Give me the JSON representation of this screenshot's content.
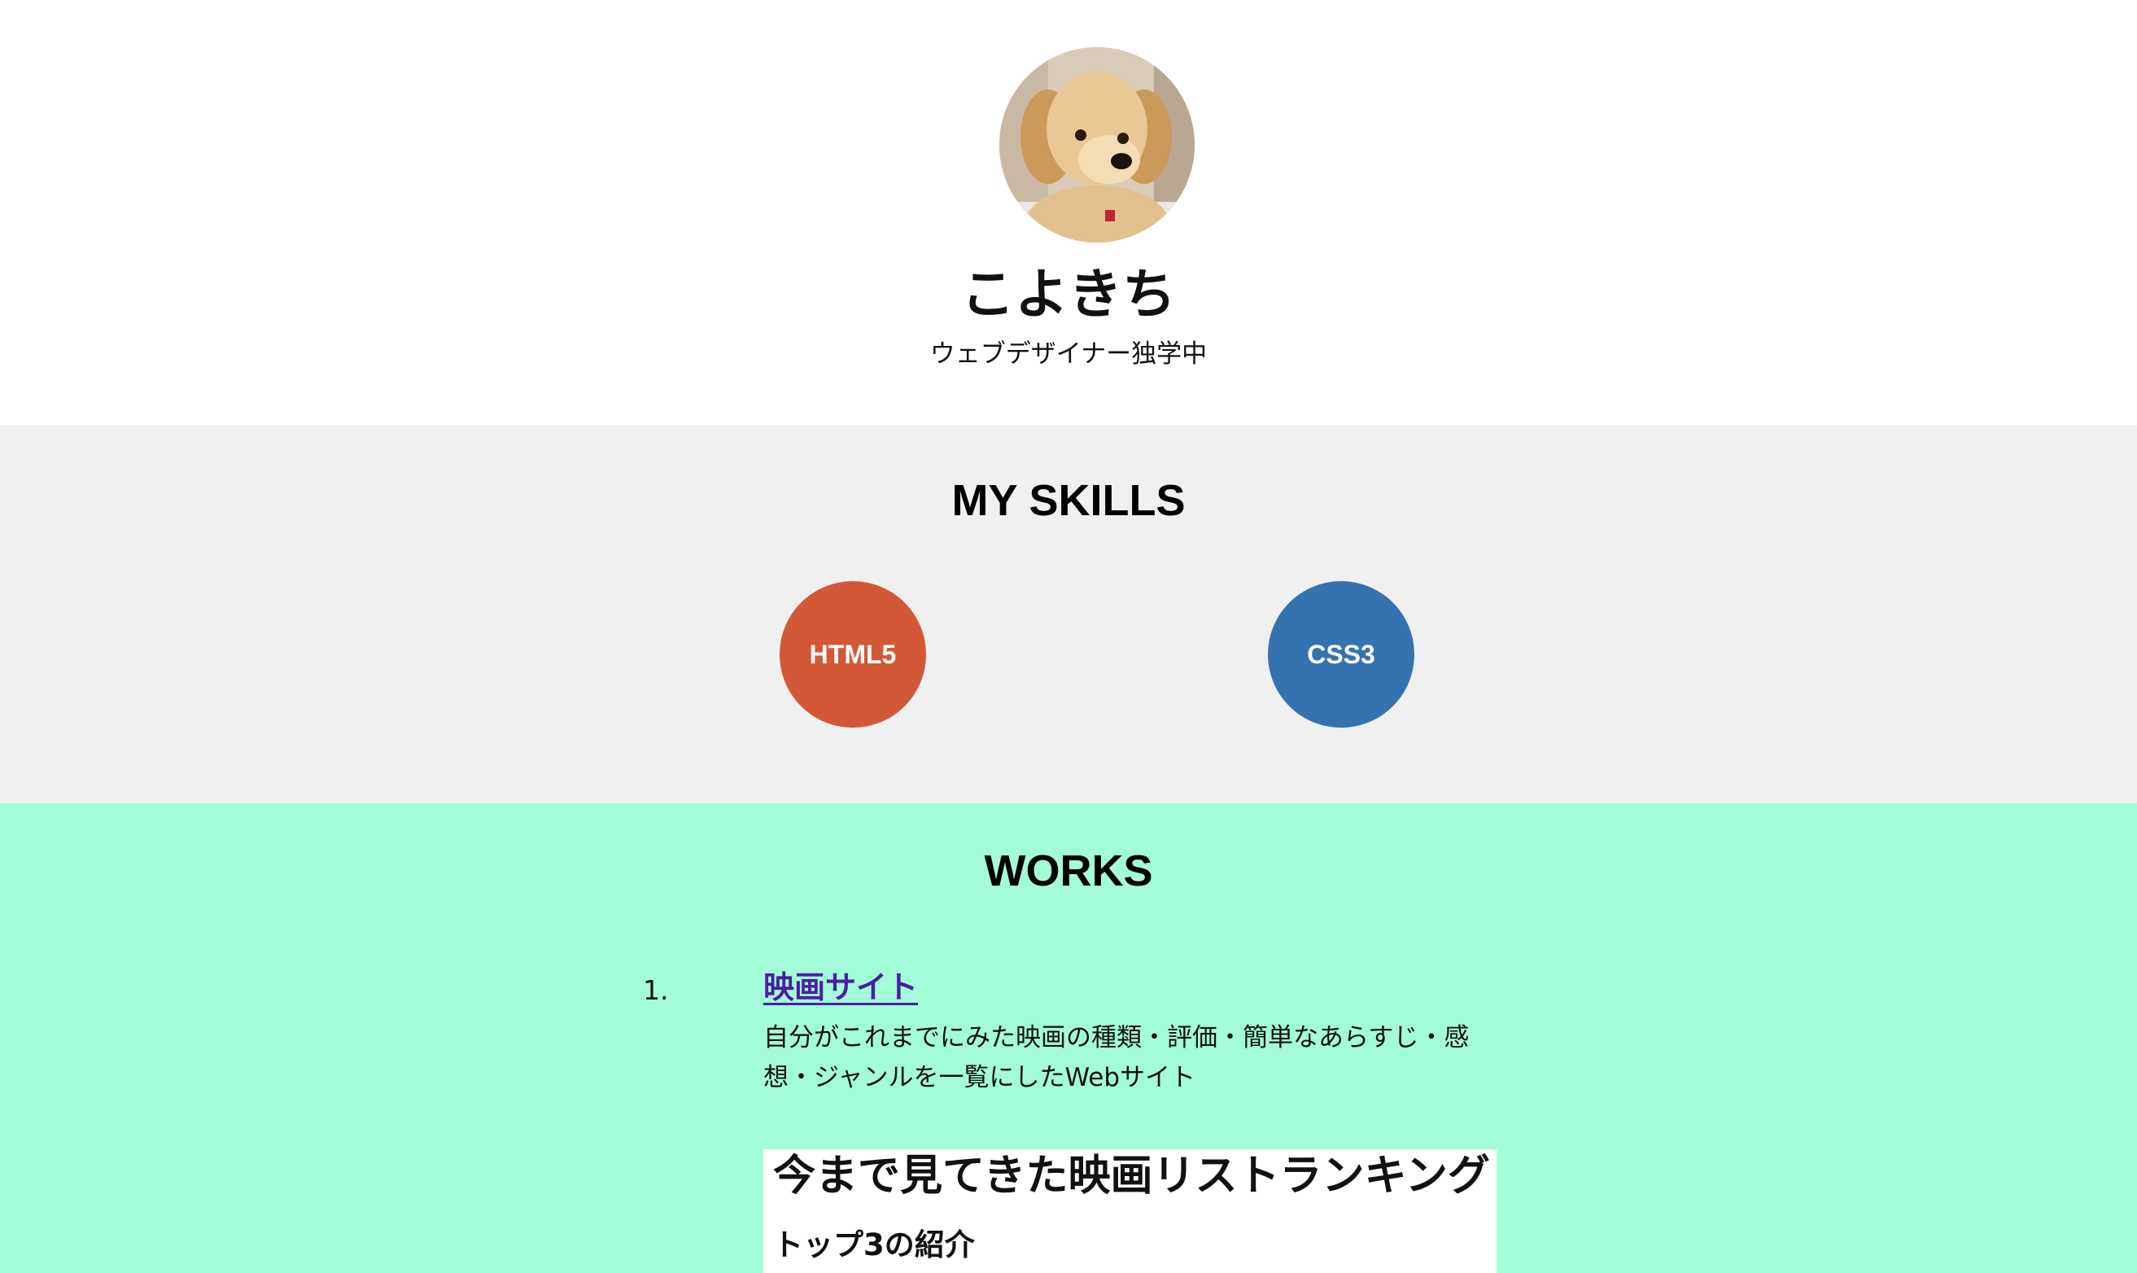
{
  "profile": {
    "avatar_alt": "puppy",
    "name": "こよきち",
    "subtitle": "ウェブデザイナー独学中"
  },
  "skills": {
    "title": "MY SKILLS",
    "items": [
      {
        "label": "HTML5",
        "color": "#d35837"
      },
      {
        "label": "CSS3",
        "color": "#3572b0"
      }
    ]
  },
  "works": {
    "title": "WORKS",
    "background": "#a2fcd7",
    "items": [
      {
        "number": "1.",
        "link_text": "映画サイト",
        "description": "自分がこれまでにみた映画の種類・評価・簡単なあらすじ・感想・ジャンルを一覧にしたWebサイト",
        "preview": {
          "title": "今まで見てきた映画リストランキング",
          "subtitle": "トップ3の紹介"
        }
      }
    ]
  }
}
